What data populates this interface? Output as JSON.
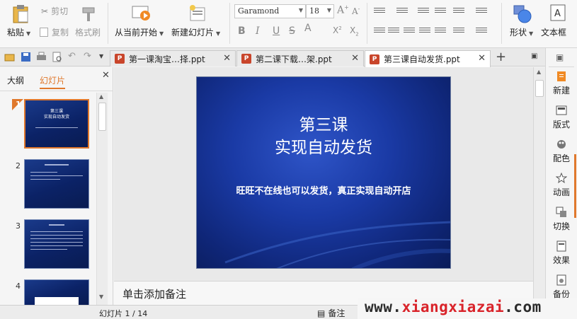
{
  "ribbon": {
    "paste": "粘贴",
    "cut": "剪切",
    "copy": "复制",
    "format_painter": "格式刷",
    "from_current": "从当前开始",
    "new_slide": "新建幻灯片",
    "font_name": "Garamond",
    "font_size": "18",
    "shape": "形状",
    "textbox": "文本框"
  },
  "tabs": [
    {
      "label": "第一课淘宝…择.ppt"
    },
    {
      "label": "第二课下载…架.ppt"
    },
    {
      "label": "第三课自动发货.ppt"
    }
  ],
  "left_panel": {
    "tab_outline": "大纲",
    "tab_slides": "幻灯片",
    "slide_numbers": [
      "1",
      "2",
      "3",
      "4"
    ]
  },
  "slide": {
    "title_line1": "第三课",
    "title_line2": "实现自动发货",
    "subtitle": "旺旺不在线也可以发货，真正实现自动开店"
  },
  "thumbs": {
    "t1_line1": "第三课",
    "t1_line2": "实现自动发货"
  },
  "notes_placeholder": "单击添加备注",
  "side_panel": [
    "新建",
    "版式",
    "配色",
    "动画",
    "切换",
    "效果",
    "备份"
  ],
  "status": {
    "slide_indicator": "幻灯片 1 / 14",
    "notes": "备注"
  },
  "watermark": {
    "prefix": "www.",
    "domain": "xiangxiazai",
    "suffix": ".com"
  },
  "colors": {
    "accent": "#e0782c",
    "slide_bg": "#1a3aa5",
    "ppt_icon": "#c9452b",
    "watermark_red": "#d9232a"
  }
}
